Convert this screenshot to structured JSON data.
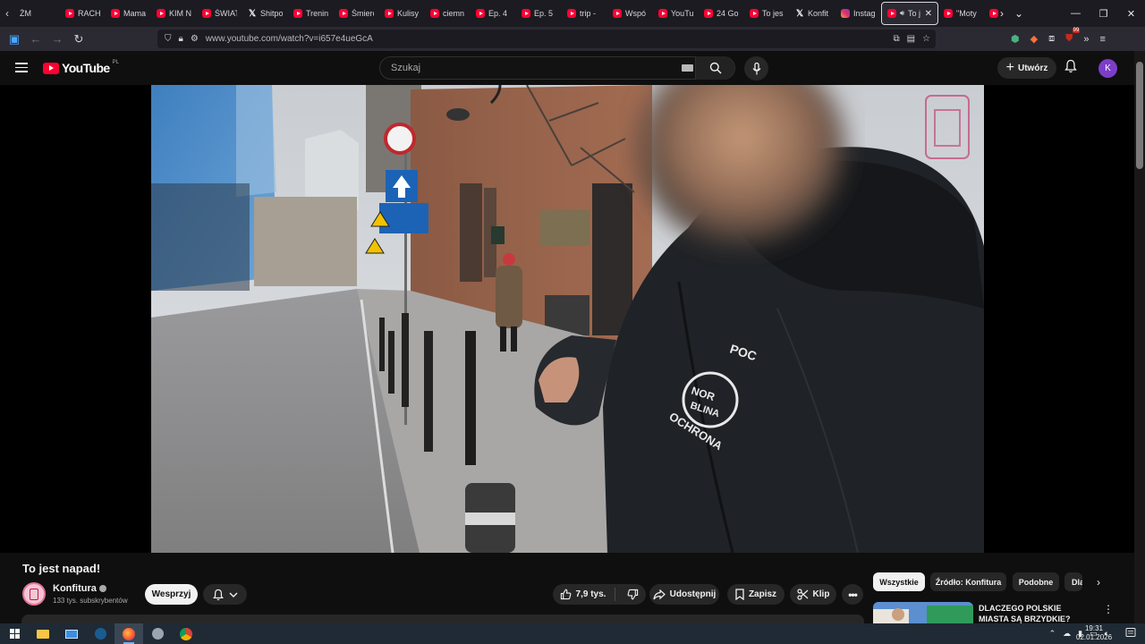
{
  "browser": {
    "tabs": [
      {
        "label": "ŻM",
        "icon": "partial",
        "active": false
      },
      {
        "label": "RACH",
        "icon": "youtube-icon",
        "active": false
      },
      {
        "label": "Mama",
        "icon": "youtube-icon",
        "active": false
      },
      {
        "label": "KIM N",
        "icon": "youtube-icon",
        "active": false
      },
      {
        "label": "ŚWIAT",
        "icon": "youtube-icon",
        "active": false
      },
      {
        "label": "Shitpo",
        "icon": "x-icon",
        "active": false
      },
      {
        "label": "Trenin",
        "icon": "youtube-icon",
        "active": false
      },
      {
        "label": "Śmierć",
        "icon": "youtube-icon",
        "active": false
      },
      {
        "label": "Kulisy",
        "icon": "youtube-icon",
        "active": false
      },
      {
        "label": "ciemn",
        "icon": "youtube-icon",
        "active": false
      },
      {
        "label": "Ep. 4",
        "icon": "youtube-icon",
        "active": false
      },
      {
        "label": "Ep. 5",
        "icon": "youtube-icon",
        "active": false
      },
      {
        "label": "trip -",
        "icon": "youtube-icon",
        "active": false
      },
      {
        "label": "Wspó",
        "icon": "youtube-icon",
        "active": false
      },
      {
        "label": "YouTu",
        "icon": "youtube-icon",
        "active": false
      },
      {
        "label": "24 Go",
        "icon": "youtube-icon",
        "active": false
      },
      {
        "label": "To jes",
        "icon": "youtube-icon",
        "active": false
      },
      {
        "label": "Konfit",
        "icon": "x-icon",
        "active": false
      },
      {
        "label": "Instag",
        "icon": "instagram-icon",
        "active": false
      },
      {
        "label": "To j",
        "icon": "youtube-icon",
        "active": true
      },
      {
        "label": "\"Moty",
        "icon": "youtube-icon",
        "active": false
      },
      {
        "label": "Jak St",
        "icon": "youtube-icon",
        "active": false
      }
    ],
    "url": "www.youtube.com/watch?v=i657e4ueGcA",
    "extension_badge": "99"
  },
  "youtube": {
    "logo_text": "YouTube",
    "region": "PL",
    "search_placeholder": "Szukaj",
    "create_label": "Utwórz",
    "avatar_letter": "K",
    "accent": "#ff0033"
  },
  "video": {
    "title": "To jest napad!",
    "channel": "Konfitura",
    "subscribers": "133 tys. subskrybentów",
    "support_label": "Wesprzyj",
    "likes": "7,9 tys.",
    "share_label": "Udostępnij",
    "save_label": "Zapisz",
    "clip_label": "Klip",
    "jacket_brand": "POC",
    "jacket_logo_line1": "NOR",
    "jacket_logo_line2": "BLINA",
    "jacket_text": "OCHRONA"
  },
  "sidebar": {
    "chips": [
      "Wszystkie",
      "Źródło: Konfitura",
      "Podobne",
      "Dla"
    ],
    "recommendation_title": "DLACZEGO POLSKIE MIASTA SĄ BRZYDKIE?"
  },
  "taskbar": {
    "time": "19:31",
    "date": "02.01.2026"
  }
}
